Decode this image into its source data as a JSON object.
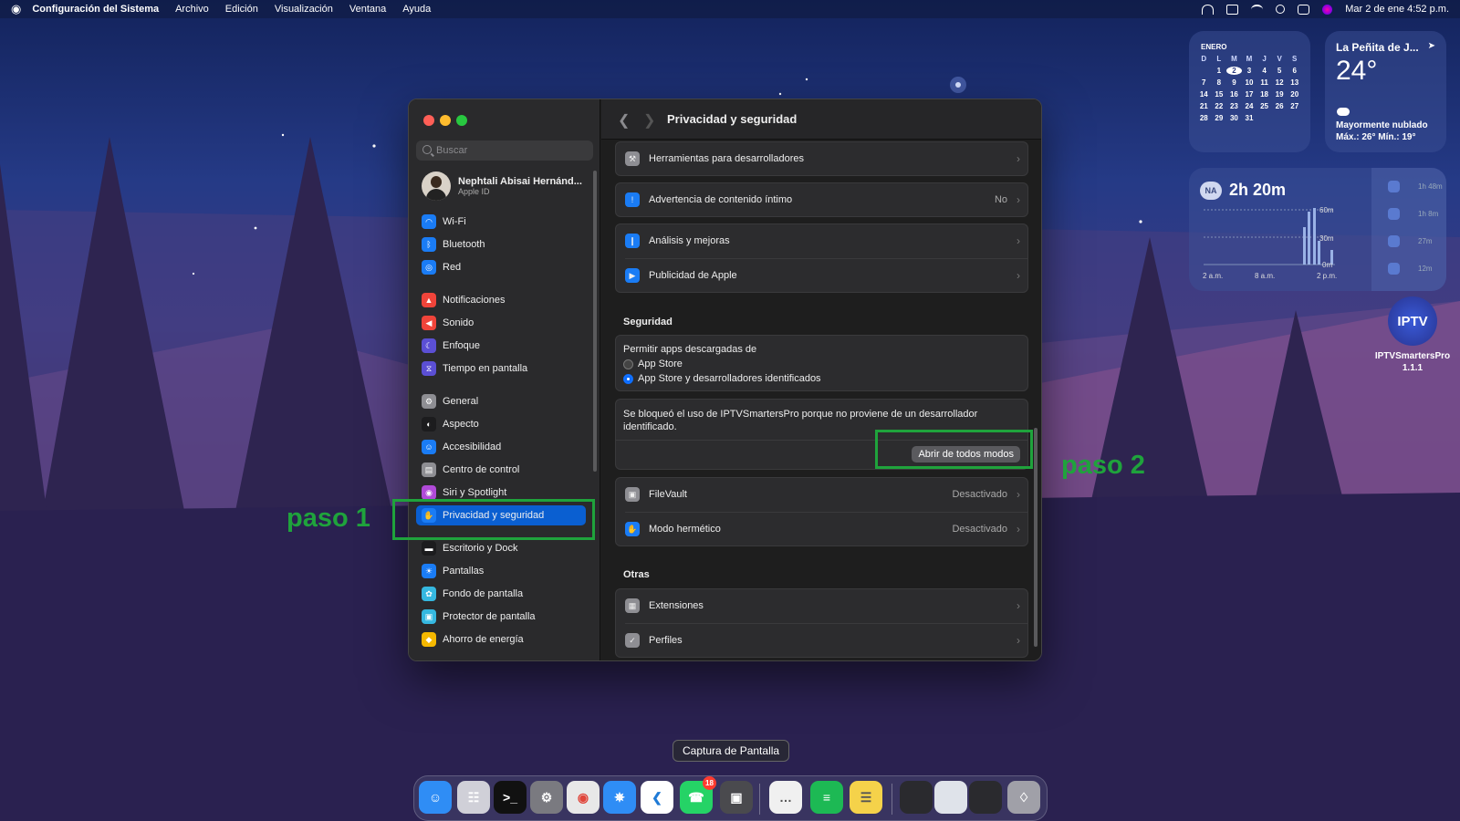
{
  "menubar": {
    "app_name": "Configuración del Sistema",
    "menus": [
      "Archivo",
      "Edición",
      "Visualización",
      "Ventana",
      "Ayuda"
    ],
    "datetime": "Mar 2 de ene  4:52 p.m."
  },
  "window": {
    "title": "Privacidad y seguridad",
    "search_placeholder": "Buscar",
    "user": {
      "name": "Nephtali Abisai Hernánd...",
      "subtitle": "Apple ID"
    },
    "sidebar": [
      {
        "label": "Wi-Fi",
        "icon": "wifi-icon",
        "color": "#1a7cf5"
      },
      {
        "label": "Bluetooth",
        "icon": "bluetooth-icon",
        "color": "#1a7cf5"
      },
      {
        "label": "Red",
        "icon": "globe-icon",
        "color": "#1a7cf5"
      },
      {
        "label": "Notificaciones",
        "icon": "bell-icon",
        "color": "#f0443a"
      },
      {
        "label": "Sonido",
        "icon": "speaker-icon",
        "color": "#f0443a"
      },
      {
        "label": "Enfoque",
        "icon": "moon-icon",
        "color": "#5b4fd4"
      },
      {
        "label": "Tiempo en pantalla",
        "icon": "hourglass-icon",
        "color": "#5b4fd4"
      },
      {
        "label": "General",
        "icon": "gear-icon",
        "color": "#8e8e93"
      },
      {
        "label": "Aspecto",
        "icon": "appearance-icon",
        "color": "#1c1c1e"
      },
      {
        "label": "Accesibilidad",
        "icon": "accessibility-icon",
        "color": "#1a7cf5"
      },
      {
        "label": "Centro de control",
        "icon": "control-center-icon",
        "color": "#8e8e93"
      },
      {
        "label": "Siri y Spotlight",
        "icon": "siri-icon",
        "color": "#b04ad8"
      },
      {
        "label": "Privacidad y seguridad",
        "icon": "hand-icon",
        "color": "#1a7cf5"
      },
      {
        "label": "Escritorio y Dock",
        "icon": "dock-icon",
        "color": "#1c1c1e"
      },
      {
        "label": "Pantallas",
        "icon": "sun-icon",
        "color": "#1a7cf5"
      },
      {
        "label": "Fondo de pantalla",
        "icon": "flower-icon",
        "color": "#35b8e0"
      },
      {
        "label": "Protector de pantalla",
        "icon": "screensaver-icon",
        "color": "#35b8e0"
      },
      {
        "label": "Ahorro de energía",
        "icon": "bulb-icon",
        "color": "#f5b800"
      }
    ],
    "rows_top": [
      {
        "label": "Herramientas para desarrolladores",
        "value": "",
        "icon": "hammer-icon",
        "color": "#8e8e93"
      },
      {
        "label": "Advertencia de contenido íntimo",
        "value": "No",
        "icon": "warning-bubble-icon",
        "color": "#1a7cf5"
      },
      {
        "label": "Análisis y mejoras",
        "value": "",
        "icon": "chart-icon",
        "color": "#1a7cf5"
      },
      {
        "label": "Publicidad de Apple",
        "value": "",
        "icon": "megaphone-icon",
        "color": "#1a7cf5"
      }
    ],
    "security": {
      "title": "Seguridad",
      "allow_label": "Permitir apps descargadas de",
      "options": [
        "App Store",
        "App Store y desarrolladores identificados"
      ],
      "selected": 1,
      "blocked_message": "Se bloqueó el uso de IPTVSmartersPro porque no proviene de un desarrollador identificado.",
      "open_button": "Abrir de todos modos",
      "rows": [
        {
          "label": "FileVault",
          "value": "Desactivado",
          "icon": "vault-icon",
          "color": "#8e8e93"
        },
        {
          "label": "Modo hermético",
          "value": "Desactivado",
          "icon": "hand-icon",
          "color": "#1a7cf5"
        }
      ]
    },
    "others": {
      "title": "Otras",
      "rows": [
        {
          "label": "Extensiones",
          "icon": "puzzle-icon",
          "color": "#8e8e93"
        },
        {
          "label": "Perfiles",
          "icon": "check-badge-icon",
          "color": "#8e8e93"
        }
      ]
    }
  },
  "annotations": {
    "step1": "paso 1",
    "step2": "paso 2",
    "color": "#1fa33c"
  },
  "calendar": {
    "month": "ENERO",
    "weekdays": [
      "D",
      "L",
      "M",
      "M",
      "J",
      "V",
      "S"
    ],
    "days": [
      "",
      "1",
      "2",
      "3",
      "4",
      "5",
      "6",
      "7",
      "8",
      "9",
      "10",
      "11",
      "12",
      "13",
      "14",
      "15",
      "16",
      "17",
      "18",
      "19",
      "20",
      "21",
      "22",
      "23",
      "24",
      "25",
      "26",
      "27",
      "28",
      "29",
      "30",
      "31",
      "",
      "",
      ""
    ],
    "today": "2"
  },
  "weather": {
    "location": "La Peñita de J...",
    "temp": "24°",
    "condition": "Mayormente nublado",
    "range": "Máx.: 26° Mín.: 19°"
  },
  "screentime": {
    "initials": "NA",
    "total": "2h 20m",
    "y_ticks": [
      "60m",
      "30m",
      "0m"
    ],
    "x_ticks": [
      "2 a.m.",
      "8 a.m.",
      "2 p.m."
    ],
    "apps": [
      {
        "time": "1h 48m",
        "icon": "app-icon"
      },
      {
        "time": "1h 8m",
        "icon": "facebook-icon"
      },
      {
        "time": "27m",
        "icon": "whatsapp-icon"
      },
      {
        "time": "12m",
        "icon": "telegram-icon"
      }
    ]
  },
  "desktop_icon": {
    "logo_text": "IPTV",
    "label_line1": "IPTVSmartersPro",
    "label_line2": "1.1.1"
  },
  "dock": {
    "tooltip": "Captura de Pantalla",
    "whatsapp_badge": "18",
    "apps": [
      {
        "name": "finder-icon",
        "color": "#2f8df5"
      },
      {
        "name": "launchpad-icon",
        "color": "#d0d0d8"
      },
      {
        "name": "terminal-icon",
        "color": "#111111"
      },
      {
        "name": "system-settings-icon",
        "color": "#7a7a80"
      },
      {
        "name": "chrome-icon",
        "color": "#e8e8e8"
      },
      {
        "name": "safari-icon",
        "color": "#2f8df5"
      },
      {
        "name": "vscode-icon",
        "color": "#ffffff"
      },
      {
        "name": "whatsapp-icon",
        "color": "#25d366"
      },
      {
        "name": "screenshot-icon",
        "color": "#4a4a4e"
      },
      {
        "name": "messages-icon",
        "color": "#f0f0f0"
      },
      {
        "name": "spotify-icon",
        "color": "#1db954"
      },
      {
        "name": "notes-icon",
        "color": "#f5d24a"
      },
      {
        "name": "window-thumb-1-icon",
        "color": "#2a2a2e"
      },
      {
        "name": "window-thumb-2-icon",
        "color": "#dfe3ea"
      },
      {
        "name": "window-thumb-3-icon",
        "color": "#2a2a2e"
      },
      {
        "name": "trash-icon",
        "color": "#a0a0a8"
      }
    ]
  }
}
